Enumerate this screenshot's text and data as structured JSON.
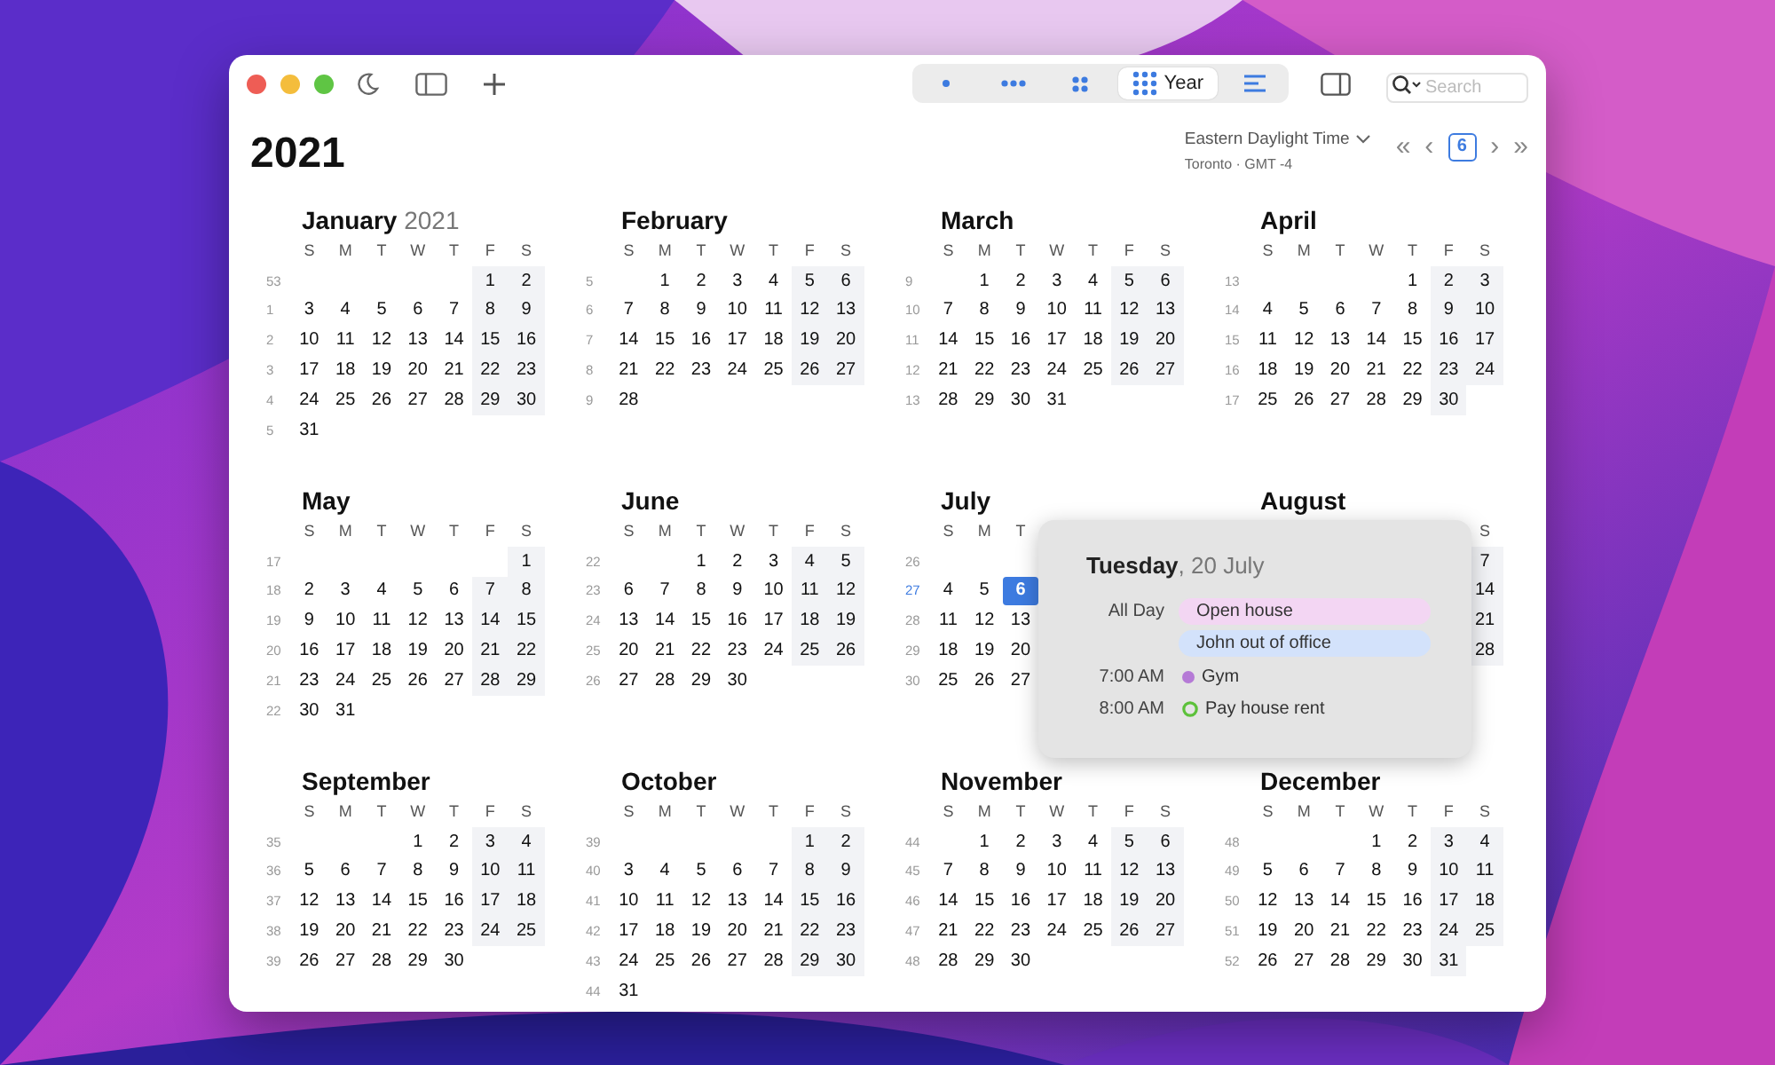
{
  "toolbar": {
    "view_switcher": [
      {
        "kind": "day",
        "selected": false
      },
      {
        "kind": "week",
        "selected": false
      },
      {
        "kind": "month",
        "selected": false
      },
      {
        "kind": "year",
        "label": "Year",
        "selected": true
      },
      {
        "kind": "list",
        "selected": false
      }
    ],
    "search": {
      "placeholder": "Search"
    }
  },
  "header": {
    "title": "2021",
    "timezone": "Eastern Daylight Time",
    "location": "Toronto · GMT -4",
    "nav": {
      "first": "«",
      "prev": "‹",
      "today": "6",
      "next": "›",
      "last": "»"
    }
  },
  "months": [
    {
      "name": "January",
      "year": "2021",
      "weekdays": [
        "S",
        "M",
        "T",
        "W",
        "T",
        "F",
        "S"
      ],
      "weeks": [
        {
          "week": "53",
          "right_aligned": true,
          "days": [
            "1",
            "2"
          ]
        },
        {
          "week": "1",
          "days": [
            "3",
            "4",
            "5",
            "6",
            "7",
            "8",
            "9"
          ]
        },
        {
          "week": "2",
          "days": [
            "10",
            "11",
            "12",
            "13",
            "14",
            "15",
            "16"
          ]
        },
        {
          "week": "3",
          "days": [
            "17",
            "18",
            "19",
            "20",
            "21",
            "22",
            "23"
          ]
        },
        {
          "week": "4",
          "days": [
            "24",
            "25",
            "26",
            "27",
            "28",
            "29",
            "30"
          ]
        },
        {
          "week": "5",
          "days": [
            "31"
          ]
        }
      ]
    },
    {
      "name": "February",
      "weekdays": [
        "S",
        "M",
        "T",
        "W",
        "T",
        "F",
        "S"
      ],
      "weeks": [
        {
          "week": "5",
          "right_aligned": true,
          "days": [
            "1",
            "2",
            "3",
            "4",
            "5",
            "6"
          ]
        },
        {
          "week": "6",
          "days": [
            "7",
            "8",
            "9",
            "10",
            "11",
            "12",
            "13"
          ]
        },
        {
          "week": "7",
          "days": [
            "14",
            "15",
            "16",
            "17",
            "18",
            "19",
            "20"
          ]
        },
        {
          "week": "8",
          "days": [
            "21",
            "22",
            "23",
            "24",
            "25",
            "26",
            "27"
          ]
        },
        {
          "week": "9",
          "days": [
            "28"
          ]
        }
      ]
    },
    {
      "name": "March",
      "weekdays": [
        "S",
        "M",
        "T",
        "W",
        "T",
        "F",
        "S"
      ],
      "weeks": [
        {
          "week": "9",
          "right_aligned": true,
          "days": [
            "1",
            "2",
            "3",
            "4",
            "5",
            "6"
          ]
        },
        {
          "week": "10",
          "days": [
            "7",
            "8",
            "9",
            "10",
            "11",
            "12",
            "13"
          ]
        },
        {
          "week": "11",
          "days": [
            "14",
            "15",
            "16",
            "17",
            "18",
            "19",
            "20"
          ]
        },
        {
          "week": "12",
          "days": [
            "21",
            "22",
            "23",
            "24",
            "25",
            "26",
            "27"
          ]
        },
        {
          "week": "13",
          "days": [
            "28",
            "29",
            "30",
            "31"
          ]
        }
      ]
    },
    {
      "name": "April",
      "weekdays": [
        "S",
        "M",
        "T",
        "W",
        "T",
        "F",
        "S"
      ],
      "weeks": [
        {
          "week": "13",
          "right_aligned": true,
          "days": [
            "1",
            "2",
            "3"
          ]
        },
        {
          "week": "14",
          "days": [
            "4",
            "5",
            "6",
            "7",
            "8",
            "9",
            "10"
          ]
        },
        {
          "week": "15",
          "days": [
            "11",
            "12",
            "13",
            "14",
            "15",
            "16",
            "17"
          ]
        },
        {
          "week": "16",
          "days": [
            "18",
            "19",
            "20",
            "21",
            "22",
            "23",
            "24"
          ]
        },
        {
          "week": "17",
          "days": [
            "25",
            "26",
            "27",
            "28",
            "29",
            "30"
          ]
        }
      ]
    },
    {
      "name": "May",
      "weekdays": [
        "S",
        "M",
        "T",
        "W",
        "T",
        "F",
        "S"
      ],
      "weeks": [
        {
          "week": "17",
          "right_aligned": true,
          "days": [
            "1"
          ]
        },
        {
          "week": "18",
          "days": [
            "2",
            "3",
            "4",
            "5",
            "6",
            "7",
            "8"
          ]
        },
        {
          "week": "19",
          "days": [
            "9",
            "10",
            "11",
            "12",
            "13",
            "14",
            "15"
          ]
        },
        {
          "week": "20",
          "days": [
            "16",
            "17",
            "18",
            "19",
            "20",
            "21",
            "22"
          ]
        },
        {
          "week": "21",
          "days": [
            "23",
            "24",
            "25",
            "26",
            "27",
            "28",
            "29"
          ]
        },
        {
          "week": "22",
          "days": [
            "30",
            "31"
          ]
        }
      ]
    },
    {
      "name": "June",
      "weekdays": [
        "S",
        "M",
        "T",
        "W",
        "T",
        "F",
        "S"
      ],
      "weeks": [
        {
          "week": "22",
          "right_aligned": true,
          "days": [
            "1",
            "2",
            "3",
            "4",
            "5"
          ]
        },
        {
          "week": "23",
          "days": [
            "6",
            "7",
            "8",
            "9",
            "10",
            "11",
            "12"
          ]
        },
        {
          "week": "24",
          "days": [
            "13",
            "14",
            "15",
            "16",
            "17",
            "18",
            "19"
          ]
        },
        {
          "week": "25",
          "days": [
            "20",
            "21",
            "22",
            "23",
            "24",
            "25",
            "26"
          ]
        },
        {
          "week": "26",
          "days": [
            "27",
            "28",
            "29",
            "30"
          ]
        }
      ]
    },
    {
      "name": "July",
      "weekdays": [
        "S",
        "M",
        "T"
      ],
      "weeks": [
        {
          "week": "26",
          "current": false
        },
        {
          "week": "27",
          "current": true,
          "days": [
            "4",
            "5",
            {
              "text": "6",
              "today": true
            }
          ]
        },
        {
          "week": "28",
          "current": false,
          "days": [
            "11",
            "12",
            "13"
          ]
        },
        {
          "week": "29",
          "current": false,
          "days": [
            "18",
            "19",
            "20"
          ]
        },
        {
          "week": "30",
          "current": false,
          "days": [
            "25",
            "26",
            "27"
          ]
        }
      ]
    },
    {
      "name": "August",
      "weekdays": [
        "S"
      ],
      "weekdays_right_aligned": true,
      "weeks": [
        {
          "right_aligned": true,
          "days": [
            "7"
          ]
        },
        {
          "right_aligned": true,
          "days": [
            "14"
          ]
        },
        {
          "right_aligned": true,
          "days": [
            "21"
          ]
        },
        {
          "right_aligned": true,
          "days": [
            "28"
          ]
        }
      ]
    },
    {
      "name": "September",
      "weekdays": [
        "S",
        "M",
        "T",
        "W",
        "T",
        "F",
        "S"
      ],
      "weeks": [
        {
          "week": "35",
          "right_aligned": true,
          "days": [
            "1",
            "2",
            "3",
            "4"
          ]
        },
        {
          "week": "36",
          "days": [
            "5",
            "6",
            "7",
            "8",
            "9",
            "10",
            "11"
          ]
        },
        {
          "week": "37",
          "days": [
            "12",
            "13",
            "14",
            "15",
            "16",
            "17",
            "18"
          ]
        },
        {
          "week": "38",
          "days": [
            "19",
            "20",
            "21",
            "22",
            "23",
            "24",
            "25"
          ]
        },
        {
          "week": "39",
          "days": [
            "26",
            "27",
            "28",
            "29",
            "30"
          ]
        }
      ]
    },
    {
      "name": "October",
      "weekdays": [
        "S",
        "M",
        "T",
        "W",
        "T",
        "F",
        "S"
      ],
      "weeks": [
        {
          "week": "39",
          "right_aligned": true,
          "days": [
            "1",
            "2"
          ]
        },
        {
          "week": "40",
          "days": [
            "3",
            "4",
            "5",
            "6",
            "7",
            "8",
            "9"
          ]
        },
        {
          "week": "41",
          "days": [
            "10",
            "11",
            "12",
            "13",
            "14",
            "15",
            "16"
          ]
        },
        {
          "week": "42",
          "days": [
            "17",
            "18",
            "19",
            "20",
            "21",
            "22",
            "23"
          ]
        },
        {
          "week": "43",
          "days": [
            "24",
            "25",
            "26",
            "27",
            "28",
            "29",
            "30"
          ]
        },
        {
          "week": "44",
          "days": [
            "31"
          ]
        }
      ]
    },
    {
      "name": "November",
      "weekdays": [
        "S",
        "M",
        "T",
        "W",
        "T",
        "F",
        "S"
      ],
      "weeks": [
        {
          "week": "44",
          "right_aligned": true,
          "days": [
            "1",
            "2",
            "3",
            "4",
            "5",
            "6"
          ]
        },
        {
          "week": "45",
          "days": [
            "7",
            "8",
            "9",
            "10",
            "11",
            "12",
            "13"
          ]
        },
        {
          "week": "46",
          "days": [
            "14",
            "15",
            "16",
            "17",
            "18",
            "19",
            "20"
          ]
        },
        {
          "week": "47",
          "days": [
            "21",
            "22",
            "23",
            "24",
            "25",
            "26",
            "27"
          ]
        },
        {
          "week": "48",
          "days": [
            "28",
            "29",
            "30"
          ]
        }
      ]
    },
    {
      "name": "December",
      "weekdays": [
        "S",
        "M",
        "T",
        "W",
        "T",
        "F",
        "S"
      ],
      "weeks": [
        {
          "week": "48",
          "right_aligned": true,
          "days": [
            "1",
            "2",
            "3",
            "4"
          ]
        },
        {
          "week": "49",
          "days": [
            "5",
            "6",
            "7",
            "8",
            "9",
            "10",
            "11"
          ]
        },
        {
          "week": "50",
          "days": [
            "12",
            "13",
            "14",
            "15",
            "16",
            "17",
            "18"
          ]
        },
        {
          "week": "51",
          "days": [
            "19",
            "20",
            "21",
            "22",
            "23",
            "24",
            "25"
          ]
        },
        {
          "week": "52",
          "days": [
            "26",
            "27",
            "28",
            "29",
            "30",
            "31"
          ]
        }
      ]
    }
  ],
  "popover": {
    "weekday": "Tuesday",
    "date": ", 20 July",
    "events": [
      {
        "kind": "all_day",
        "time": "All Day",
        "title": "Open house",
        "color": "#f3d6f3"
      },
      {
        "kind": "all_day",
        "title": "John out of office",
        "color": "#d3e2fb"
      },
      {
        "kind": "dot",
        "time": "7:00 AM",
        "title": "Gym",
        "color": "#b57ad6"
      },
      {
        "kind": "ring",
        "time": "8:00 AM",
        "title": "Pay house rent",
        "color": "#5cc13a"
      }
    ]
  }
}
